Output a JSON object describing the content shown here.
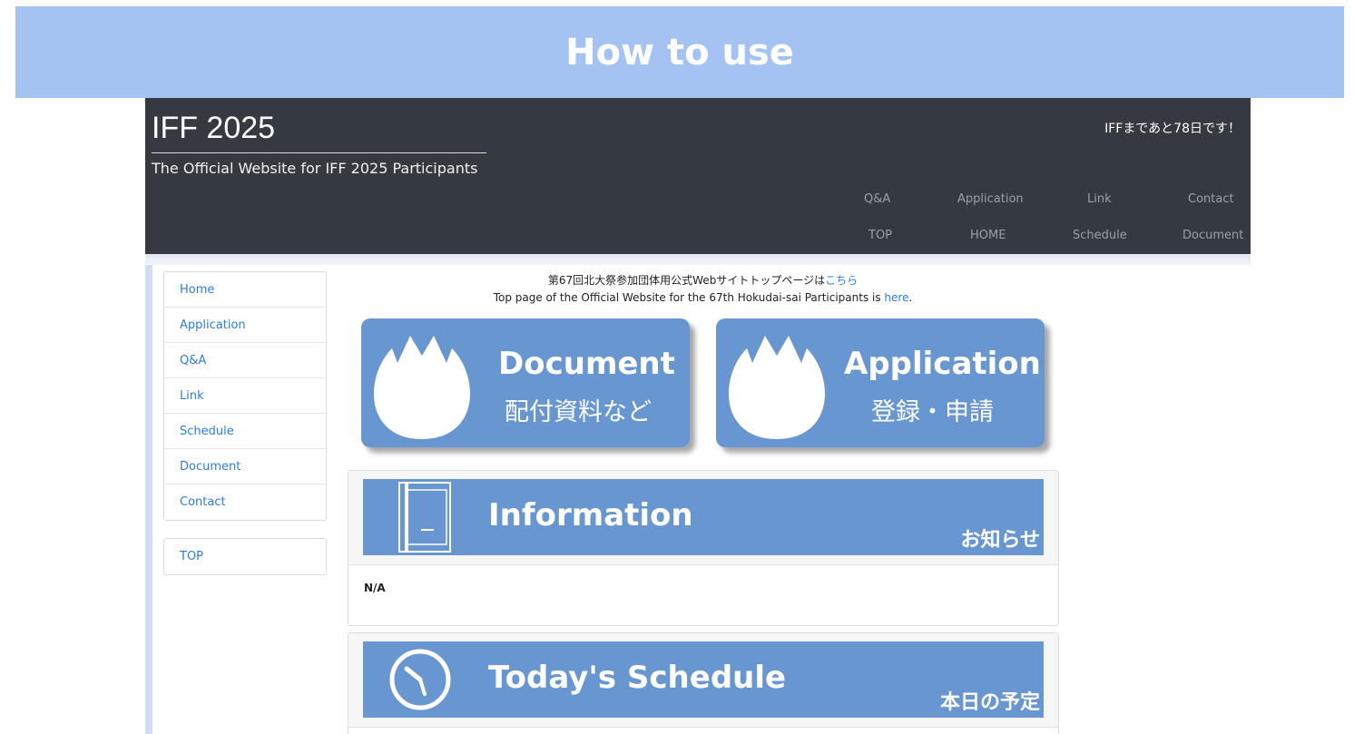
{
  "banner": {
    "title": "How to use"
  },
  "header": {
    "title": "IFF 2025",
    "subtitle": "The Official Website for IFF 2025 Participants",
    "countdown": "IFFまであと78日です！"
  },
  "nav": {
    "row1": [
      "Q&A",
      "Application",
      "Link",
      "Contact"
    ],
    "row2": [
      "TOP",
      "HOME",
      "Schedule",
      "Document"
    ]
  },
  "sidebar": {
    "items": [
      "Home",
      "Application",
      "Q&A",
      "Link",
      "Schedule",
      "Document",
      "Contact"
    ],
    "top": "TOP"
  },
  "notice": {
    "jp_text": "第67回北大祭参加団体用公式Webサイトトップページは",
    "jp_link": "こちら",
    "en_text": "Top page of the Official Website for the 67th Hokudai-sai Participants is ",
    "en_link": "here",
    "en_end": "."
  },
  "buttons": {
    "document": {
      "title": "Document",
      "sub": "配付資料など"
    },
    "application": {
      "title": "Application",
      "sub": "登録・申請"
    }
  },
  "information": {
    "title": "Information",
    "jp": "お知らせ",
    "content": "N/A"
  },
  "schedule": {
    "title": "Today's Schedule",
    "jp": "本日の予定"
  },
  "colors": {
    "banner": "#a4c3f3",
    "header": "#343a40",
    "tile": "#6896d0",
    "link": "#2b7de0"
  }
}
